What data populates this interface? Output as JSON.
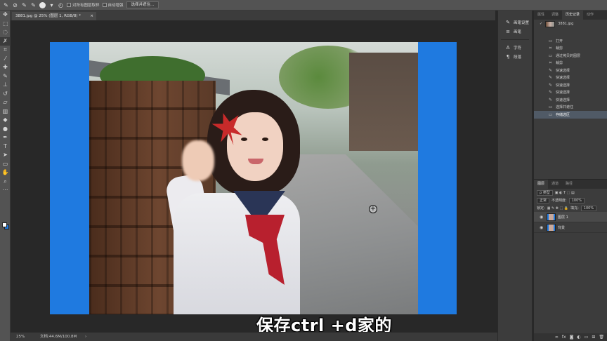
{
  "options_bar": {
    "sample_all_layers": "对所有图层取样",
    "auto_enhance": "自动增强",
    "select_and_mask_button": "选择并遮住..."
  },
  "document": {
    "tab_title": "3881.jpg @ 25% (图层 1, RGB/8) *",
    "close_glyph": "×",
    "background_color": "#1f7ae0",
    "video_subtitle": "保存ctrl +d家的"
  },
  "status_bar": {
    "zoom": "25%",
    "doc_info": "文档:44.6M/100.8M",
    "arrow": "›"
  },
  "dock": {
    "items": [
      {
        "icon": "brush-settings-icon",
        "glyph": "✎",
        "label": "画笔设置"
      },
      {
        "icon": "brush-icon",
        "glyph": "≡",
        "label": "画笔"
      },
      {
        "icon": "character-icon",
        "glyph": "A",
        "label": "字符"
      },
      {
        "icon": "paragraph-icon",
        "glyph": "¶",
        "label": "段落"
      }
    ]
  },
  "panels": {
    "top_tabs": [
      "属性",
      "调整",
      "历史记录",
      "动作"
    ],
    "active_top_tab": 2,
    "history": {
      "snapshot_label": "3881.jpg",
      "steps": [
        {
          "icon": "open-icon",
          "label": "打开",
          "selected": false
        },
        {
          "icon": "crop-icon",
          "label": "裁剪",
          "selected": false
        },
        {
          "icon": "layer-icon",
          "label": "通过拷贝的图层",
          "selected": false
        },
        {
          "icon": "crop-icon",
          "label": "裁剪",
          "selected": false
        },
        {
          "icon": "quick-select-icon",
          "label": "快速选择",
          "selected": false
        },
        {
          "icon": "quick-select-icon",
          "label": "快速选择",
          "selected": false
        },
        {
          "icon": "quick-select-icon",
          "label": "快速选择",
          "selected": false
        },
        {
          "icon": "quick-select-icon",
          "label": "快速选择",
          "selected": false
        },
        {
          "icon": "quick-select-icon",
          "label": "快速选择",
          "selected": false
        },
        {
          "icon": "select-mask-icon",
          "label": "选择并遮住",
          "selected": false
        },
        {
          "icon": "save-selection-icon",
          "label": "存储选区",
          "selected": true
        }
      ]
    },
    "layer_tabs": [
      "图层",
      "通道",
      "路径"
    ],
    "active_layer_tab": 0,
    "filter_kind": "ρ 类型",
    "blend_mode": "正常",
    "opacity_label": "不透明度:",
    "opacity_value": "100%",
    "lock_label": "锁定:",
    "fill_label": "填充:",
    "fill_value": "100%",
    "layers": [
      {
        "name": "图层 1",
        "selected": true
      },
      {
        "name": "背景",
        "selected": false
      }
    ]
  }
}
